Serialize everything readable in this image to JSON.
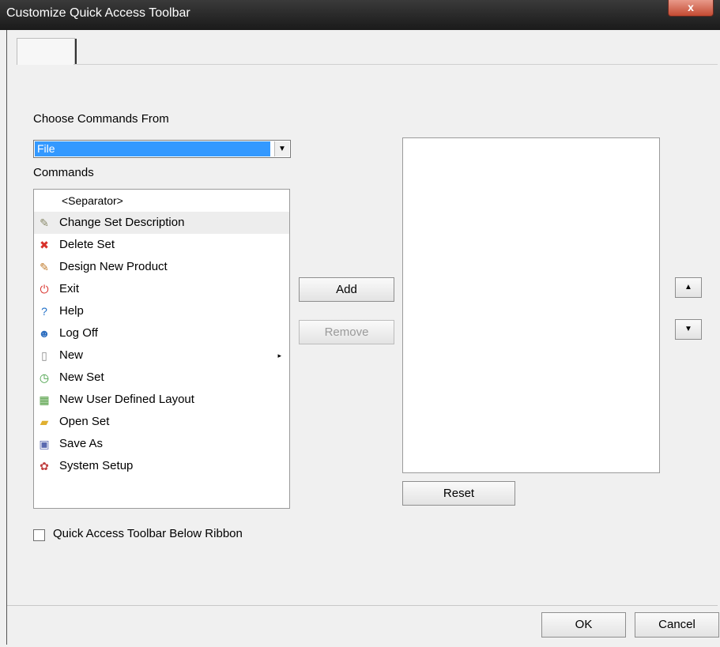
{
  "window": {
    "title": "Customize Quick Access Toolbar",
    "close_glyph": "x"
  },
  "choose_label": "Choose Commands From",
  "choose_value": "File",
  "commands_label": "Commands",
  "commands": [
    {
      "label": "<Separator>",
      "icon": "none",
      "type": "separator"
    },
    {
      "label": "Change Set Description",
      "icon": "pencil-icon",
      "glyph": "✎",
      "color": "#8a8a6a"
    },
    {
      "label": "Delete Set",
      "icon": "red-x-icon",
      "glyph": "✖",
      "color": "#d8302a"
    },
    {
      "label": "Design New Product",
      "icon": "design-icon",
      "glyph": "✎",
      "color": "#c07a2a"
    },
    {
      "label": "Exit",
      "icon": "power-icon",
      "glyph": "⏻",
      "color": "#d8302a"
    },
    {
      "label": "Help",
      "icon": "help-icon",
      "glyph": "?",
      "color": "#1f6fc8"
    },
    {
      "label": "Log Off",
      "icon": "user-icon",
      "glyph": "☻",
      "color": "#2f6fc0"
    },
    {
      "label": "New",
      "icon": "blank-page-icon",
      "glyph": "▯",
      "color": "#8a8a8a",
      "submenu": true
    },
    {
      "label": "New Set",
      "icon": "new-set-icon",
      "glyph": "◷",
      "color": "#3a9a3a"
    },
    {
      "label": "New User Defined Layout",
      "icon": "layout-icon",
      "glyph": "▦",
      "color": "#4a9a3a"
    },
    {
      "label": "Open Set",
      "icon": "folder-icon",
      "glyph": "▰",
      "color": "#e0b030"
    },
    {
      "label": "Save As",
      "icon": "save-icon",
      "glyph": "▣",
      "color": "#5a6ab0"
    },
    {
      "label": "System Setup",
      "icon": "gears-icon",
      "glyph": "✿",
      "color": "#c04040"
    }
  ],
  "buttons": {
    "add": "Add",
    "remove": "Remove",
    "reset": "Reset",
    "ok": "OK",
    "cancel": "Cancel"
  },
  "checkbox_label": "Quick Access Toolbar Below Ribbon",
  "submenu_glyph": "▸",
  "up_glyph": "▲",
  "down_glyph": "▼",
  "dropdown_glyph": "▼"
}
